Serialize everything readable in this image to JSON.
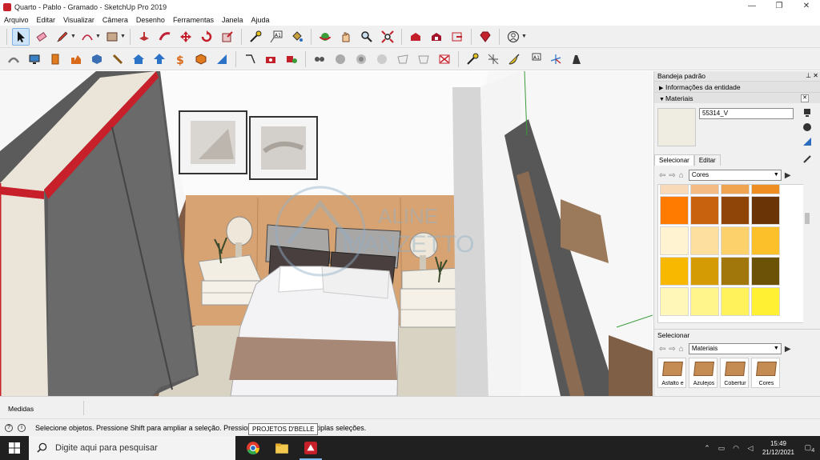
{
  "window": {
    "title": "Quarto - Pablo - Gramado - SketchUp Pro 2019",
    "controls": [
      "—",
      "❐",
      "✕"
    ]
  },
  "menu": [
    "Arquivo",
    "Editar",
    "Visualizar",
    "Câmera",
    "Desenho",
    "Ferramentas",
    "Janela",
    "Ajuda"
  ],
  "toolbar1": {
    "active_tool": "select-tool",
    "icons": [
      "select-icon",
      "eraser-icon",
      "pencil-icon",
      "arc-icon",
      "rectangle-icon",
      "push-pull-icon",
      "follow-me-icon",
      "move-icon",
      "rotate-icon",
      "scale-icon",
      "tape-measure-icon",
      "text-icon",
      "paint-bucket-icon",
      "orbit-icon",
      "pan-icon",
      "zoom-icon",
      "zoom-extents-icon",
      "warehouse-icon",
      "extension-icon",
      "share-icon",
      "ruby-icon",
      "account-icon"
    ]
  },
  "toolbar2": {
    "icons": [
      "sandbox-icon",
      "display-icon",
      "box-icon",
      "chart-icon",
      "component-icon",
      "tool-icon",
      "home-icon",
      "arrow-up-icon",
      "dollar-icon",
      "cube-icon",
      "layout-icon",
      "section-icon",
      "camera-icon",
      "shapes-icon",
      "shape2-icon",
      "shape3-icon",
      "shape4-icon",
      "plane-icon",
      "plane2-icon",
      "no-icon",
      "dimension-icon",
      "protractor-icon",
      "axes-icon",
      "text-3d-icon",
      "tripod-icon"
    ]
  },
  "watermark": {
    "line1": "ALINE",
    "line2": "MANZETTO"
  },
  "tray": {
    "title": "Bandeja padrão",
    "entity_info": "Informações da entidade",
    "materials": "Materiais",
    "material_name": "55314_V",
    "tab_select": "Selecionar",
    "tab_edit": "Editar",
    "library": "Cores",
    "select_header": "Selecionar",
    "library2": "Materiais",
    "tiles": [
      "Asfalto e",
      "Azulejos",
      "Cobertur",
      "Cores"
    ]
  },
  "swatch_colors": [
    [
      "#f8d9b8",
      "#f4bb84",
      "#f0a44f",
      "#ed8d22"
    ],
    [
      "#ff7b00",
      "#c9620f",
      "#8f4508",
      "#6b3406"
    ],
    [
      "#fff3d2",
      "#fde0a0",
      "#fcd06a",
      "#fcc12a"
    ],
    [
      "#f9b800",
      "#d49b05",
      "#a1770b",
      "#6b5207"
    ],
    [
      "#fff7b8",
      "#fff58a",
      "#fff25b",
      "#fff033"
    ]
  ],
  "measures": {
    "label": "Medidas"
  },
  "status": {
    "text": "Selecione objetos. Pressione Shift para ampliar a seleção. Pressione Ctrl para fazer múltiplas seleções.",
    "badge": "PROJETOS D'BELLE"
  },
  "taskbar": {
    "search_placeholder": "Digite aqui para pesquisar",
    "time": "15:49",
    "date": "21/12/2021",
    "notifications": "4"
  }
}
